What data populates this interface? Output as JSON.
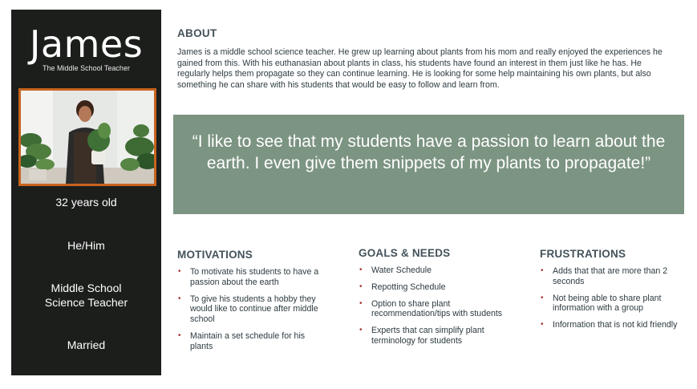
{
  "persona": {
    "name": "James",
    "subtitle": "The Middle School Teacher",
    "age": "32 years old",
    "pronouns": "He/Him",
    "occupation_line1": "Middle School",
    "occupation_line2": "Science Teacher",
    "status": "Married"
  },
  "about": {
    "heading": "ABOUT",
    "text": "James is a middle school science teacher. He grew up learning about plants from his mom and really enjoyed the experiences he gained from this. With his euthanasian about plants in class, his students have found an interest in them just like he has. He regularly helps them propagate so they can continue learning. He is looking for some help maintaining his own plants, but also something he can share with his students that would be easy to follow and learn from."
  },
  "quote": {
    "text": "“I like to see that my students have a passion to learn about the earth. I even give them snippets of my plants to propagate!”"
  },
  "motivations": {
    "heading": "MOTIVATIONS",
    "items": [
      "To motivate his students to have a passion about the earth",
      "To give his students a hobby they would like to continue after middle school",
      "Maintain a set schedule for his plants"
    ]
  },
  "goals": {
    "heading": "GOALS & NEEDS",
    "items": [
      "Water Schedule",
      "Repotting Schedule",
      "Option to share plant recommendation/tips with students",
      "Experts that can simplify plant terminology for students"
    ]
  },
  "frustrations": {
    "heading": "FRUSTRATIONS",
    "items": [
      "Adds that that are more than 2 seconds",
      "Not being able to share plant information with a group",
      "Information that is not kid friendly"
    ]
  },
  "colors": {
    "sidebar": "#1c1e1c",
    "photo_frame": "#c8641e",
    "quote_bg": "#7c9482",
    "bullet": "#a53a34"
  }
}
